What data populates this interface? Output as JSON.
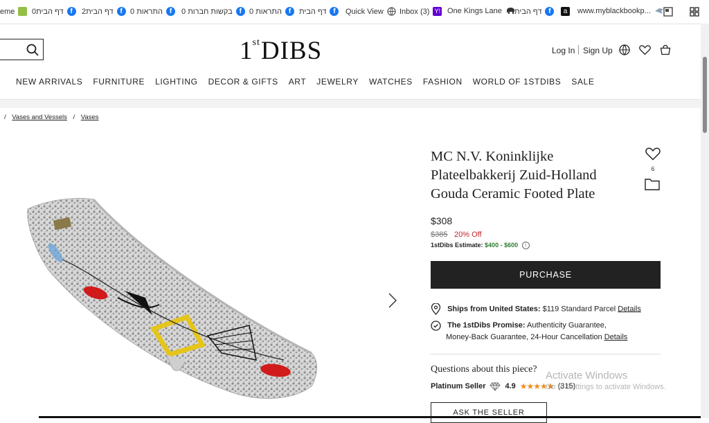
{
  "bookmarks": [
    {
      "label": "eme",
      "icon": "shopify-icon"
    },
    {
      "label": "דף הבית0",
      "icon": "facebook-icon"
    },
    {
      "label": "דף הבית2",
      "icon": "facebook-icon"
    },
    {
      "label": "0 התראות",
      "icon": "facebook-icon"
    },
    {
      "label": "0 בקשות חברות",
      "icon": "facebook-icon"
    },
    {
      "label": "0 התראות",
      "icon": "facebook-icon"
    },
    {
      "label": "דף הבית",
      "icon": "facebook-icon"
    },
    {
      "label": "Quick View",
      "icon": "globe-icon"
    },
    {
      "label": "Inbox (3)",
      "icon": "yahoo-icon"
    },
    {
      "label": "One Kings Lane",
      "icon": "elephant-icon"
    },
    {
      "label": "דף הבית",
      "icon": "facebook-icon"
    },
    {
      "label": "",
      "icon": "amazon-icon"
    },
    {
      "label": "www.myblackbookp...",
      "icon": "bird-icon"
    }
  ],
  "header": {
    "logo_main": "1",
    "logo_st": "st",
    "logo_rest": "DIBS",
    "login": "Log In",
    "signup": "Sign Up"
  },
  "nav": [
    "NEW ARRIVALS",
    "FURNITURE",
    "LIGHTING",
    "DECOR & GIFTS",
    "ART",
    "JEWELRY",
    "WATCHES",
    "FASHION",
    "WORLD OF 1STDIBS",
    "SALE"
  ],
  "breadcrumbs": [
    "Vases and Vessels",
    "Vases"
  ],
  "product": {
    "title": "MC N.V. Koninklijke Plateelbakkerij Zuid-Holland Gouda Ceramic Footed Plate",
    "favorites_count": "6",
    "price": "$308",
    "old_price": "$385",
    "discount": "20% Off",
    "estimate_label": "1stDibs Estimate:",
    "estimate_range": "$400 - $600",
    "purchase_label": "PURCHASE",
    "ships_bold": "Ships from United States:",
    "ships_text": "$119 Standard Parcel",
    "details_label": "Details",
    "promise_bold": "The 1stDibs Promise:",
    "promise_text1": "Authenticity Guarantee,",
    "promise_text2": "Money-Back Guarantee, 24-Hour Cancellation",
    "questions": "Questions about this piece?",
    "seller_tier": "Platinum Seller",
    "seller_rating": "4.9",
    "stars": "★★★★★",
    "review_count": "(315)",
    "ask_label": "ASK THE SELLER"
  },
  "watermark": {
    "line1": "Activate Windows",
    "line2": "Go to Settings to activate Windows."
  },
  "colors": {
    "accent_dark": "#222222",
    "discount_red": "#c2262e",
    "estimate_green": "#2e7d32",
    "star_orange": "#f08c1b",
    "facebook_blue": "#1877f2"
  }
}
